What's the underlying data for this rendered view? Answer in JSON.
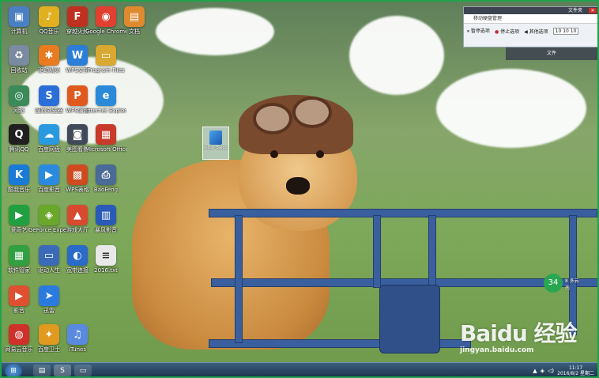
{
  "window": {
    "title": "文件夹",
    "subtitle": "移动硬盘管理",
    "btn_start": "暂停选项",
    "btn_stop": "停止选项",
    "btn_other": "其他选项",
    "field": "10 10 10",
    "second_title": "文件"
  },
  "desktop_icons": [
    {
      "label": "计算机",
      "icon": "computer-icon",
      "color": "#4a7fc4",
      "glyph": "▣"
    },
    {
      "label": "QQ音乐",
      "icon": "qq-music-icon",
      "color": "#e0b020",
      "glyph": "♪"
    },
    {
      "label": "穿越火线",
      "icon": "crossfire-icon",
      "color": "#c03020",
      "glyph": "F"
    },
    {
      "label": "Google Chrome",
      "icon": "chrome-icon",
      "color": "#e04030",
      "glyph": "◉"
    },
    {
      "label": "文档",
      "icon": "document-icon",
      "color": "#e08a30",
      "glyph": "▤"
    },
    {
      "label": "回收站",
      "icon": "recycle-bin-icon",
      "color": "#7a8aa0",
      "glyph": "♻"
    },
    {
      "label": "驱动精灵",
      "icon": "driver-icon",
      "color": "#e87a20",
      "glyph": "✱"
    },
    {
      "label": "WPS文字",
      "icon": "wps-writer-icon",
      "color": "#2a7ed8",
      "glyph": "W"
    },
    {
      "label": "Program Files",
      "icon": "folder-icon",
      "color": "#d8a830",
      "glyph": "▭"
    },
    {
      "label": "网络",
      "icon": "network-icon",
      "color": "#3a8a5a",
      "glyph": "◎"
    },
    {
      "label": "搜狗浏览器",
      "icon": "sogou-icon",
      "color": "#2a6ed8",
      "glyph": "S"
    },
    {
      "label": "WPS演示",
      "icon": "wps-present-icon",
      "color": "#e05a20",
      "glyph": "P"
    },
    {
      "label": "Internet Explorer",
      "icon": "ie-icon",
      "color": "#2a8ad8",
      "glyph": "e"
    },
    {
      "label": "腾讯QQ",
      "icon": "qq-icon",
      "color": "#202020",
      "glyph": "Q"
    },
    {
      "label": "百度网盘",
      "icon": "netdisk-icon",
      "color": "#2a9ae0",
      "glyph": "☁"
    },
    {
      "label": "美图看看",
      "icon": "camera-icon",
      "color": "#404a58",
      "glyph": "◙"
    },
    {
      "label": "Microsoft Office",
      "icon": "office-icon",
      "color": "#c83a2a",
      "glyph": "▦"
    },
    {
      "label": "酷我音乐",
      "icon": "kuwo-icon",
      "color": "#1a7ad8",
      "glyph": "K"
    },
    {
      "label": "百度影音",
      "icon": "video-icon",
      "color": "#2a8ae0",
      "glyph": "▶"
    },
    {
      "label": "WPS表格",
      "icon": "wps-sheet-icon",
      "color": "#d04a20",
      "glyph": "▩"
    },
    {
      "label": "BaoFeng",
      "icon": "printer-icon",
      "color": "#4a6a98",
      "glyph": "⎙"
    },
    {
      "label": "爱奇艺",
      "icon": "iqiyi-icon",
      "color": "#20a040",
      "glyph": "▶"
    },
    {
      "label": "GeForce Experience",
      "icon": "nvidia-icon",
      "color": "#6aa82a",
      "glyph": "◈"
    },
    {
      "label": "游戏大厅",
      "icon": "game-icon",
      "color": "#d84a30",
      "glyph": "▲"
    },
    {
      "label": "暴风影音",
      "icon": "player-icon",
      "color": "#2a5ab8",
      "glyph": "▥"
    },
    {
      "label": "软件管家",
      "icon": "software-icon",
      "color": "#30a040",
      "glyph": "▦"
    },
    {
      "label": "驱动人生",
      "icon": "monitor-icon",
      "color": "#3a6ab8",
      "glyph": "▭"
    },
    {
      "label": "宽带连接",
      "icon": "broadband-icon",
      "color": "#2a6ac8",
      "glyph": "◐"
    },
    {
      "label": "2016.txt",
      "icon": "text-file-icon",
      "color": "#e8e8e8",
      "glyph": "≡"
    },
    {
      "label": "影音",
      "icon": "media-icon",
      "color": "#e05030",
      "glyph": "▶"
    },
    {
      "label": "迅雷",
      "icon": "thunder-icon",
      "color": "#2a7ae0",
      "glyph": "➤"
    },
    {
      "label": "网易云音乐",
      "icon": "music-icon",
      "color": "#d0302a",
      "glyph": "◍"
    },
    {
      "label": "百度卫士",
      "icon": "guard-icon",
      "color": "#e09a20",
      "glyph": "✦"
    },
    {
      "label": "iTunes",
      "icon": "itunes-icon",
      "color": "#5a8ae0",
      "glyph": "♫"
    },
    {
      "label": "QQ影音",
      "icon": "qq-video-icon",
      "color": "#2a9ad8",
      "glyph": "▣"
    }
  ],
  "selected_file": {
    "label": "setup_Baidu..."
  },
  "weather": {
    "temp": "34",
    "line1": "8 多云",
    "line2": "南"
  },
  "watermark": {
    "logo": "Baidu 经验",
    "url": "jingyan.baidu.com"
  },
  "taskbar": {
    "time": "11:17",
    "date": "2016/8/2 星期二",
    "items": [
      "start",
      "explorer",
      "sogou",
      "window"
    ]
  }
}
